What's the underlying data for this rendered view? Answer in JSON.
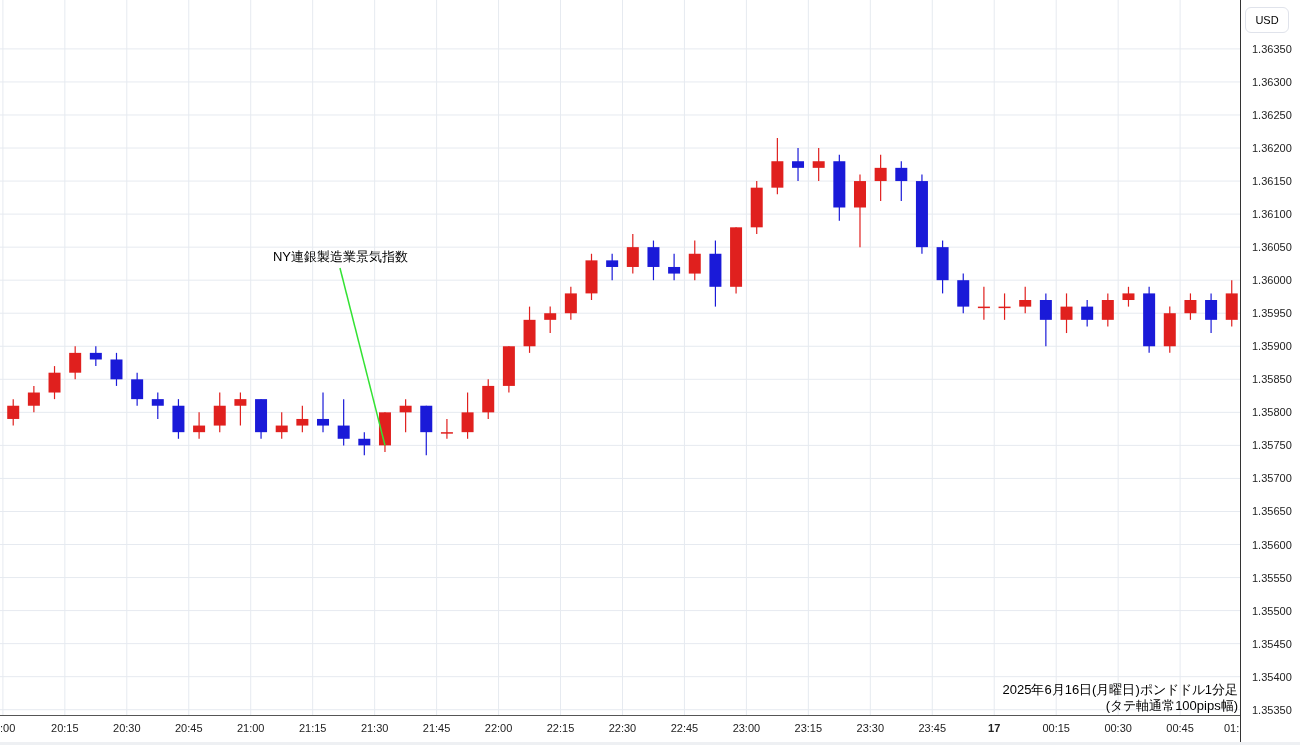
{
  "currency_button": "USD",
  "caption": [
    "2025年6月16日(月曜日)ポンドドル1分足",
    "(タテ軸通常100pips幅)"
  ],
  "time_axis_edge_labels": [
    ":00",
    "01:"
  ],
  "next_day_time_labels": [
    "17",
    "00:15",
    "00:30",
    "00:45"
  ],
  "chart_data": {
    "type": "candlestick",
    "x": [
      1202.5,
      1207.5,
      1212.5,
      1217.5,
      1222.5,
      1227.5,
      1232.5,
      1237.5,
      1242.5,
      1247.5,
      1252.5,
      1257.5,
      1262.5,
      1267.5,
      1272.5,
      1277.5,
      1282.5,
      1287.5,
      1292.5,
      1297.5,
      1302.5,
      1307.5,
      1312.5,
      1317.5,
      1322.5,
      1327.5,
      1332.5,
      1337.5,
      1342.5,
      1347.5,
      1352.5,
      1357.5,
      1362.5,
      1367.5,
      1372.5,
      1377.5,
      1382.5,
      1387.5,
      1392.5,
      1397.5,
      1402.5,
      1407.5,
      1412.5,
      1417.5,
      1422.5,
      1427.5,
      1432.5,
      1437.5,
      1442.5,
      1447.5,
      1452.5,
      1457.5,
      1462.5,
      1467.5,
      1472.5,
      1477.5,
      1482.5,
      1487.5,
      1492.5,
      1497.5
    ],
    "xlim": [
      1199.3,
      1499.5
    ],
    "ylim": [
      1.35342,
      1.36424
    ],
    "grid": true,
    "ohlc": [
      [
        1.3579,
        1.3582,
        1.3578,
        1.3581
      ],
      [
        1.3581,
        1.3584,
        1.358,
        1.3583
      ],
      [
        1.3583,
        1.3587,
        1.3582,
        1.3586
      ],
      [
        1.3586,
        1.359,
        1.3585,
        1.3589
      ],
      [
        1.3589,
        1.359,
        1.3587,
        1.3588
      ],
      [
        1.3588,
        1.3589,
        1.3584,
        1.3585
      ],
      [
        1.3585,
        1.3586,
        1.3581,
        1.3582
      ],
      [
        1.3582,
        1.3583,
        1.3579,
        1.3581
      ],
      [
        1.3581,
        1.3582,
        1.3576,
        1.3577
      ],
      [
        1.3577,
        1.358,
        1.3576,
        1.3578
      ],
      [
        1.3578,
        1.3583,
        1.3577,
        1.3581
      ],
      [
        1.3581,
        1.3583,
        1.3578,
        1.3582
      ],
      [
        1.3582,
        1.3582,
        1.3576,
        1.3577
      ],
      [
        1.3577,
        1.358,
        1.3576,
        1.3578
      ],
      [
        1.3578,
        1.3581,
        1.3577,
        1.3579
      ],
      [
        1.3579,
        1.3583,
        1.3577,
        1.3578
      ],
      [
        1.3578,
        1.3582,
        1.3575,
        1.3576
      ],
      [
        1.3576,
        1.3577,
        1.35735,
        1.3575
      ],
      [
        1.3575,
        1.358,
        1.3574,
        1.358
      ],
      [
        1.358,
        1.3582,
        1.3577,
        1.3581
      ],
      [
        1.3581,
        1.3581,
        1.35735,
        1.3577
      ],
      [
        1.3577,
        1.3579,
        1.3576,
        1.3577
      ],
      [
        1.3577,
        1.3583,
        1.3576,
        1.358
      ],
      [
        1.358,
        1.3585,
        1.3579,
        1.3584
      ],
      [
        1.3584,
        1.359,
        1.3583,
        1.359
      ],
      [
        1.359,
        1.3596,
        1.3589,
        1.3594
      ],
      [
        1.3594,
        1.3596,
        1.3592,
        1.3595
      ],
      [
        1.3595,
        1.3599,
        1.3594,
        1.3598
      ],
      [
        1.3598,
        1.3604,
        1.3597,
        1.3603
      ],
      [
        1.3603,
        1.3604,
        1.36,
        1.3602
      ],
      [
        1.3602,
        1.3607,
        1.3601,
        1.3605
      ],
      [
        1.3605,
        1.3606,
        1.36,
        1.3602
      ],
      [
        1.3602,
        1.3604,
        1.36,
        1.3601
      ],
      [
        1.3601,
        1.3606,
        1.36,
        1.3604
      ],
      [
        1.3604,
        1.3606,
        1.3596,
        1.3599
      ],
      [
        1.3599,
        1.3608,
        1.3598,
        1.3608
      ],
      [
        1.3608,
        1.3615,
        1.3607,
        1.3614
      ],
      [
        1.3614,
        1.36215,
        1.3613,
        1.3618
      ],
      [
        1.3618,
        1.362,
        1.3615,
        1.3617
      ],
      [
        1.3617,
        1.362,
        1.3615,
        1.3618
      ],
      [
        1.3618,
        1.3619,
        1.3609,
        1.3611
      ],
      [
        1.3611,
        1.3616,
        1.3605,
        1.3615
      ],
      [
        1.3615,
        1.3619,
        1.3612,
        1.3617
      ],
      [
        1.3617,
        1.3618,
        1.3612,
        1.3615
      ],
      [
        1.3615,
        1.3616,
        1.3604,
        1.3605
      ],
      [
        1.3605,
        1.3606,
        1.3598,
        1.36
      ],
      [
        1.36,
        1.3601,
        1.3595,
        1.3596
      ],
      [
        1.3596,
        1.3599,
        1.3594,
        1.3596
      ],
      [
        1.3596,
        1.3598,
        1.3594,
        1.3596
      ],
      [
        1.3596,
        1.3599,
        1.3595,
        1.3597
      ],
      [
        1.3597,
        1.3598,
        1.359,
        1.3594
      ],
      [
        1.3594,
        1.3598,
        1.3592,
        1.3596
      ],
      [
        1.3596,
        1.3597,
        1.3593,
        1.3594
      ],
      [
        1.3594,
        1.3598,
        1.3593,
        1.3597
      ],
      [
        1.3597,
        1.3599,
        1.3596,
        1.3598
      ],
      [
        1.3598,
        1.3599,
        1.3589,
        1.359
      ],
      [
        1.359,
        1.3596,
        1.3589,
        1.3595
      ],
      [
        1.3595,
        1.3598,
        1.3594,
        1.3597
      ],
      [
        1.3597,
        1.3598,
        1.3592,
        1.3594
      ],
      [
        1.3594,
        1.36,
        1.3593,
        1.3598
      ]
    ],
    "xticks": [
      {
        "value": 1215,
        "label": "20:15"
      },
      {
        "value": 1230,
        "label": "20:30"
      },
      {
        "value": 1245,
        "label": "20:45"
      },
      {
        "value": 1260,
        "label": "21:00"
      },
      {
        "value": 1275,
        "label": "21:15"
      },
      {
        "value": 1290,
        "label": "21:30"
      },
      {
        "value": 1305,
        "label": "21:45"
      },
      {
        "value": 1320,
        "label": "22:00"
      },
      {
        "value": 1335,
        "label": "22:15"
      },
      {
        "value": 1350,
        "label": "22:30"
      },
      {
        "value": 1365,
        "label": "22:45"
      },
      {
        "value": 1380,
        "label": "23:00"
      },
      {
        "value": 1395,
        "label": "23:15"
      },
      {
        "value": 1410,
        "label": "23:30"
      },
      {
        "value": 1425,
        "label": "23:45"
      }
    ],
    "yticks": [
      {
        "value": 1.3635,
        "label": "1.36350"
      },
      {
        "value": 1.363,
        "label": "1.36300"
      },
      {
        "value": 1.3625,
        "label": "1.36250"
      },
      {
        "value": 1.362,
        "label": "1.36200"
      },
      {
        "value": 1.3615,
        "label": "1.36150"
      },
      {
        "value": 1.361,
        "label": "1.36100"
      },
      {
        "value": 1.3605,
        "label": "1.36050"
      },
      {
        "value": 1.36,
        "label": "1.36000"
      },
      {
        "value": 1.3595,
        "label": "1.35950"
      },
      {
        "value": 1.359,
        "label": "1.35900"
      },
      {
        "value": 1.3585,
        "label": "1.35850"
      },
      {
        "value": 1.358,
        "label": "1.35800"
      },
      {
        "value": 1.3575,
        "label": "1.35750"
      },
      {
        "value": 1.357,
        "label": "1.35700"
      },
      {
        "value": 1.3565,
        "label": "1.35650"
      },
      {
        "value": 1.356,
        "label": "1.35600"
      },
      {
        "value": 1.3555,
        "label": "1.35550"
      },
      {
        "value": 1.355,
        "label": "1.35500"
      },
      {
        "value": 1.3545,
        "label": "1.35450"
      },
      {
        "value": 1.354,
        "label": "1.35400"
      },
      {
        "value": 1.3535,
        "label": "1.35350"
      }
    ],
    "annotations": [
      "NY連銀製造業景気指数"
    ]
  }
}
